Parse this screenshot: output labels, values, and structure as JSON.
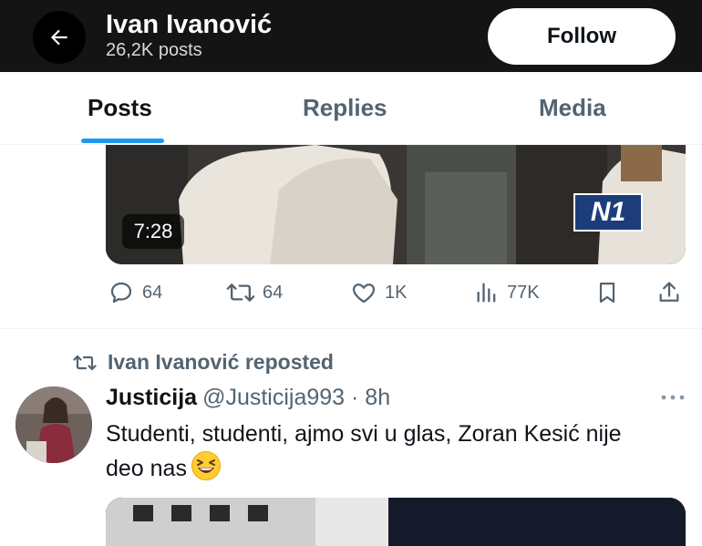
{
  "header": {
    "name": "Ivan Ivanović",
    "post_count": "26,2K posts",
    "follow_label": "Follow"
  },
  "tabs": [
    {
      "label": "Posts",
      "active": true
    },
    {
      "label": "Replies",
      "active": false
    },
    {
      "label": "Media",
      "active": false
    }
  ],
  "post1": {
    "video_duration": "7:28",
    "channel_logo": "N1",
    "stats": {
      "replies": "64",
      "reposts": "64",
      "likes": "1K",
      "views": "77K"
    }
  },
  "post2": {
    "repost_label": "Ivan Ivanović reposted",
    "author_name": "Justicija",
    "author_handle": "@Justicija993 · 8h",
    "text": "Studenti, studenti, ajmo svi u glas, Zoran Kesić nije deo nas"
  },
  "icons": {
    "back": "arrow-left-icon",
    "reply": "comment-icon",
    "repost": "repost-icon",
    "like": "heart-icon",
    "views": "analytics-icon",
    "bookmark": "bookmark-icon",
    "share": "share-icon",
    "more": "more-icon"
  },
  "colors": {
    "header_bg": "#141414",
    "accent": "#1d9bf0",
    "muted": "#536471",
    "text": "#0f1419"
  }
}
